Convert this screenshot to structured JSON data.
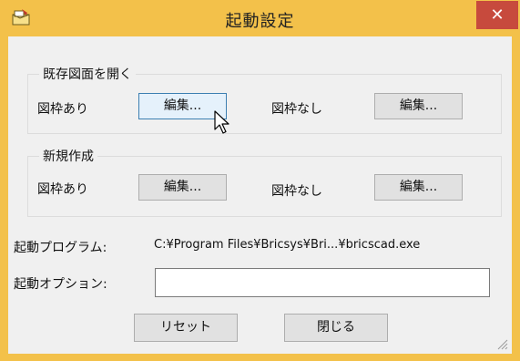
{
  "window": {
    "title": "起動設定",
    "close_glyph": "✕"
  },
  "existing_drawing": {
    "group_label": "既存図面を開く",
    "with_frame_label": "図枠あり",
    "with_frame_edit": "編集...",
    "without_frame_label": "図枠なし",
    "without_frame_edit": "編集..."
  },
  "new_drawing": {
    "group_label": "新規作成",
    "with_frame_label": "図枠あり",
    "with_frame_edit": "編集...",
    "without_frame_label": "図枠なし",
    "without_frame_edit": "編集..."
  },
  "startup_program": {
    "label": "起動プログラム:",
    "value": "C:¥Program Files¥Bricsys¥Bri...¥bricscad.exe"
  },
  "startup_options": {
    "label": "起動オプション:",
    "value": ""
  },
  "footer": {
    "reset_label": "リセット",
    "close_label": "閉じる"
  },
  "colors": {
    "titlebar": "#f3c14a",
    "close_button": "#c74a3d",
    "client": "#f0f0f0",
    "hover_button": "#e5f1fb"
  }
}
